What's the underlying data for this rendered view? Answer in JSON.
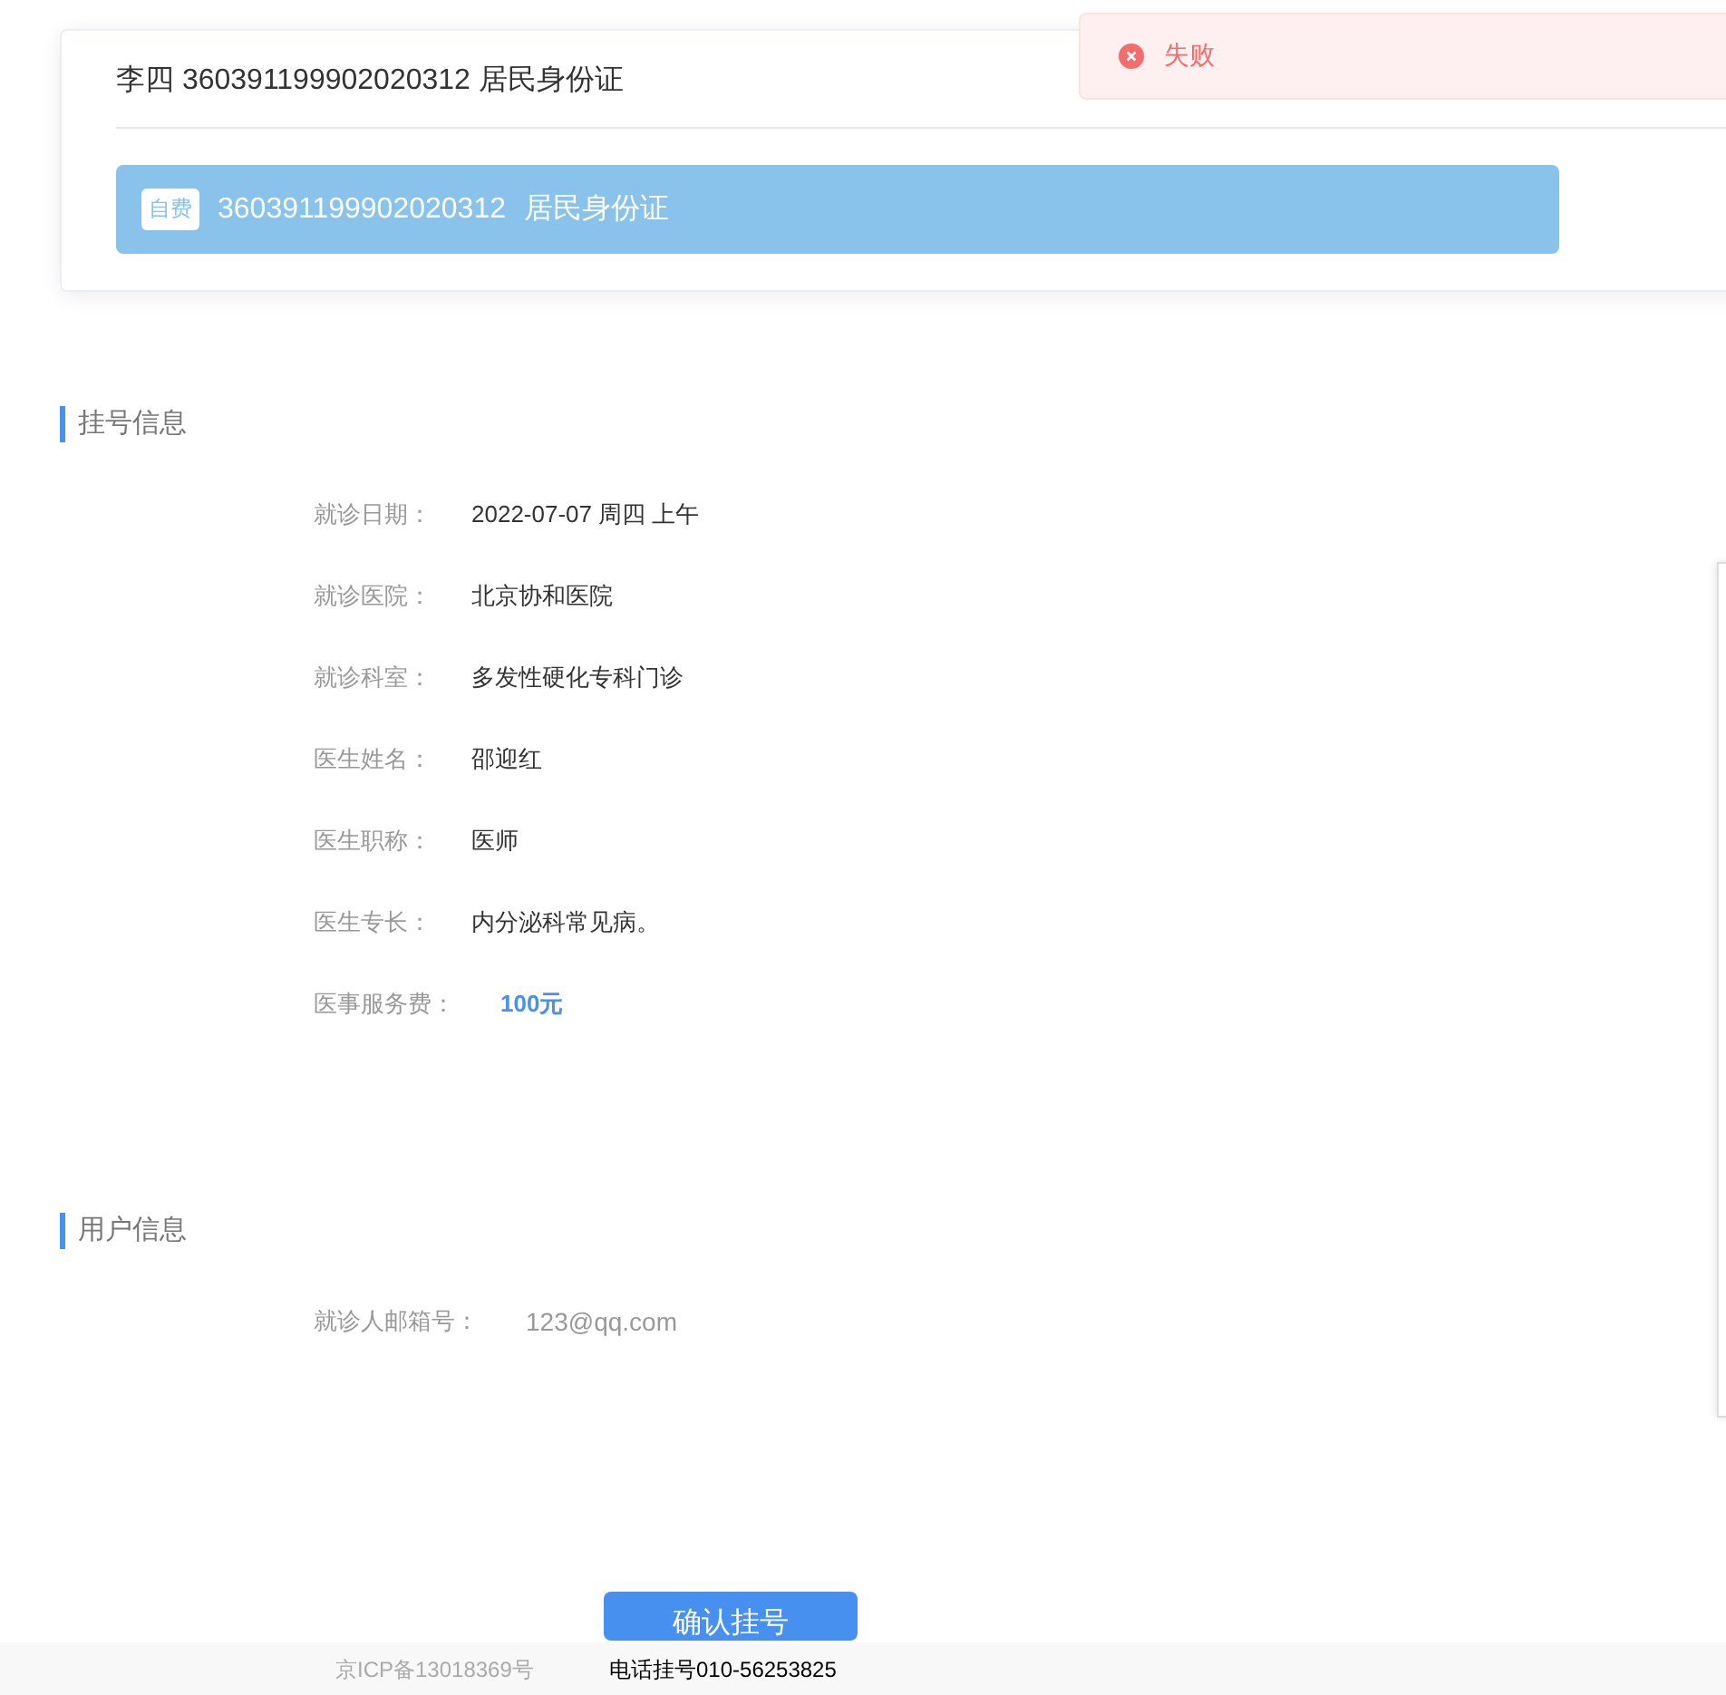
{
  "toast": {
    "kind": "error",
    "message": "失败"
  },
  "patient_card": {
    "title": "李四 360391199902020312 居民身份证",
    "options": [
      {
        "badge": "自费",
        "id_number": "360391199902020312",
        "id_type": "居民身份证",
        "selected": true
      }
    ]
  },
  "sections": [
    {
      "heading": "挂号信息",
      "rows": [
        {
          "label": "就诊日期：",
          "value": "2022-07-07 周四 上午",
          "kind": "plain"
        },
        {
          "label": "就诊医院：",
          "value": "北京协和医院",
          "kind": "plain"
        },
        {
          "label": "就诊科室：",
          "value": "多发性硬化专科门诊",
          "kind": "plain"
        },
        {
          "label": "医生姓名：",
          "value": "邵迎红",
          "kind": "plain"
        },
        {
          "label": "医生职称：",
          "value": "医师",
          "kind": "plain"
        },
        {
          "label": "医生专长：",
          "value": "内分泌科常见病。",
          "kind": "plain"
        },
        {
          "label": "医事服务费：",
          "value": "100元",
          "kind": "price"
        }
      ]
    },
    {
      "heading": "用户信息",
      "rows": [
        {
          "label": "就诊人邮箱号：",
          "value": "123@qq.com",
          "kind": "muted"
        }
      ]
    }
  ],
  "confirm_button": "确认挂号",
  "footer": {
    "icp": "京ICP备13018369号",
    "phone": "电话挂号010-56253825"
  }
}
